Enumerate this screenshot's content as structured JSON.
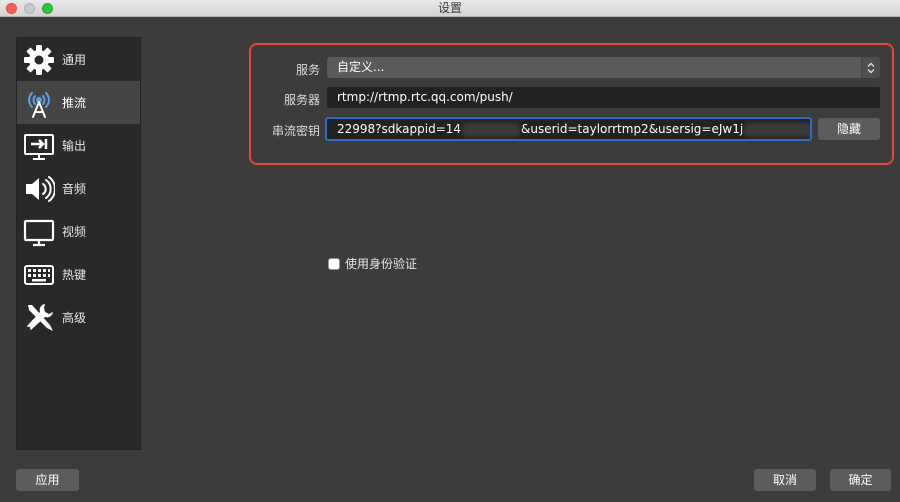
{
  "window": {
    "title": "设置"
  },
  "sidebar": {
    "items": [
      {
        "label": "通用",
        "icon": "gear-icon"
      },
      {
        "label": "推流",
        "icon": "broadcast-tower-icon",
        "active": true
      },
      {
        "label": "输出",
        "icon": "output-monitor-icon"
      },
      {
        "label": "音频",
        "icon": "speaker-icon"
      },
      {
        "label": "视频",
        "icon": "monitor-icon"
      },
      {
        "label": "热键",
        "icon": "keyboard-icon"
      },
      {
        "label": "高级",
        "icon": "tools-icon"
      }
    ]
  },
  "stream": {
    "service_label": "服务",
    "service_value": "自定义...",
    "server_label": "服务器",
    "server_value": "rtmp://rtmp.rtc.qq.com/push/",
    "key_label": "串流密钥",
    "key_part1": "22998?sdkappid=14",
    "key_part2": "&userid=taylorrtmp2&usersig=eJw1j",
    "hide_button": "隐藏",
    "auth_label": "使用身份验证",
    "auth_checked": false
  },
  "footer": {
    "apply": "应用",
    "cancel": "取消",
    "ok": "确定"
  },
  "colors": {
    "highlight": "#e8453c",
    "focus": "#2f6cc9",
    "background": "#3c3c3c",
    "sidebar": "#292929"
  }
}
